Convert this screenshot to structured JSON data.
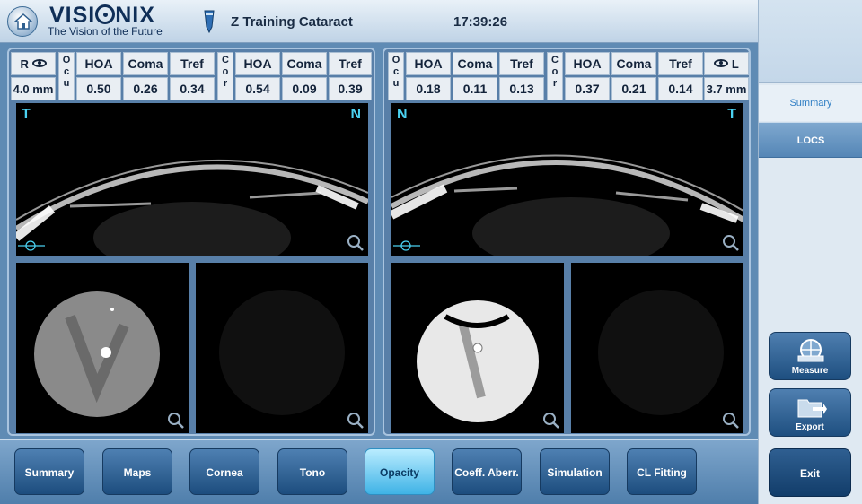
{
  "header": {
    "brand": "VISIONIX",
    "brand_left": "VISI",
    "brand_right": "NIX",
    "tagline": "The Vision of the Future",
    "patient": "Z Training Cataract",
    "time": "17:39:26"
  },
  "right_eye": {
    "eye_label": "R",
    "pupil": "4.0 mm",
    "ocular_letters": [
      "O",
      "c",
      "u"
    ],
    "corneal_letters": [
      "C",
      "o",
      "r"
    ],
    "headers": [
      "HOA",
      "Coma",
      "Tref"
    ],
    "ocular": [
      "0.50",
      "0.26",
      "0.34"
    ],
    "corneal": [
      "0.54",
      "0.09",
      "0.39"
    ],
    "dir_left": "T",
    "dir_right": "N"
  },
  "left_eye": {
    "eye_label": "L",
    "pupil": "3.7 mm",
    "ocular_letters": [
      "O",
      "c",
      "u"
    ],
    "corneal_letters": [
      "C",
      "o",
      "r"
    ],
    "headers": [
      "HOA",
      "Coma",
      "Tref"
    ],
    "ocular": [
      "0.18",
      "0.11",
      "0.13"
    ],
    "corneal": [
      "0.37",
      "0.21",
      "0.14"
    ],
    "dir_left": "N",
    "dir_right": "T"
  },
  "sidebar": {
    "summary_label": "Summary",
    "locs_label": "LOCS",
    "measure_label": "Measure",
    "export_label": "Export",
    "exit_label": "Exit"
  },
  "tabs": [
    "Summary",
    "Maps",
    "Cornea",
    "Tono",
    "Opacity",
    "Coeff. Aberr.",
    "Simulation",
    "CL Fitting"
  ],
  "active_tab": "Opacity",
  "colors": {
    "accent": "#4ad0f0",
    "panel": "#587fa8",
    "active_tab": "#3fb3e6"
  }
}
